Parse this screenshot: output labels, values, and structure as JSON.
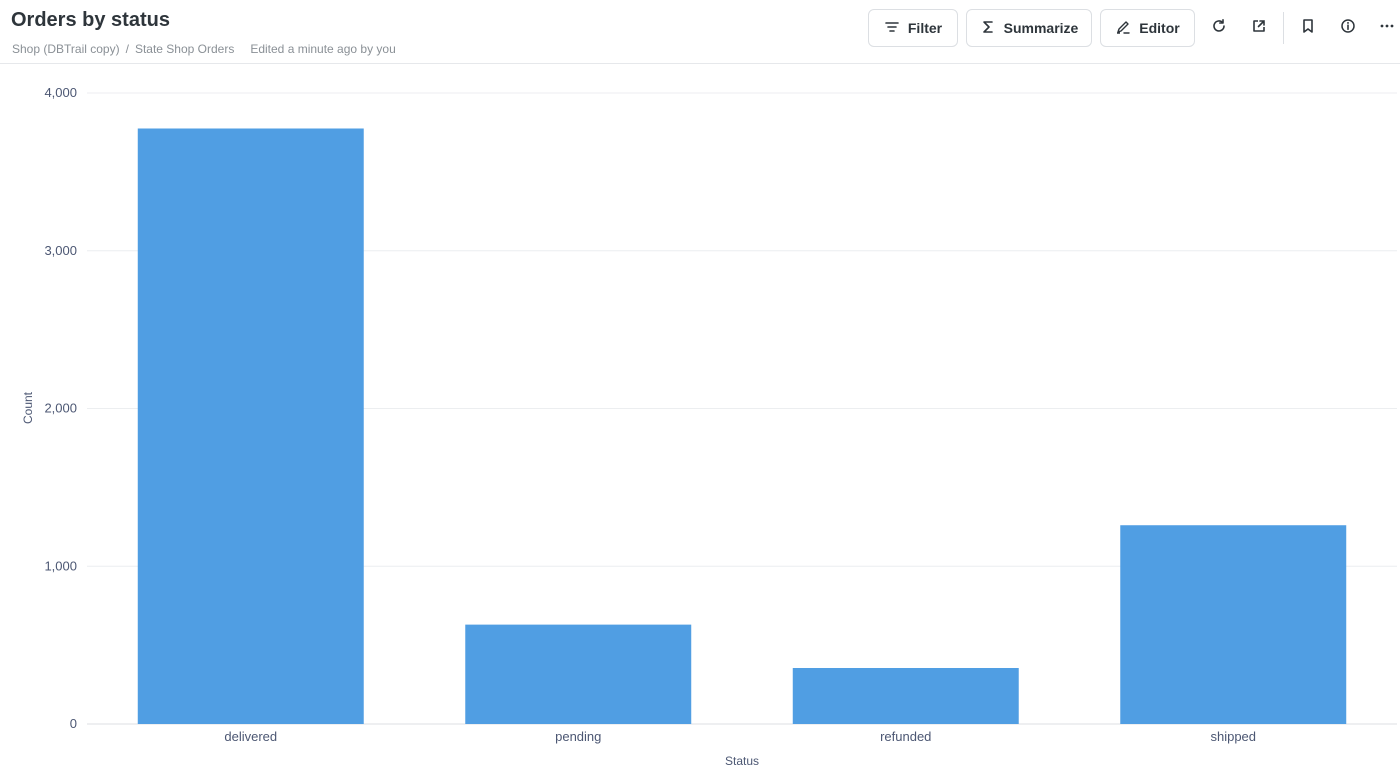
{
  "header": {
    "title": "Orders by status",
    "breadcrumb": [
      "Shop (DBTrail copy)",
      "State Shop Orders"
    ],
    "breadcrumb_sep": "/",
    "edited": "Edited a minute ago by you",
    "buttons": {
      "filter": "Filter",
      "summarize": "Summarize",
      "editor": "Editor"
    },
    "icons": [
      "filter-icon",
      "sigma-icon",
      "pencil-icon",
      "refresh-icon",
      "share-icon",
      "bookmark-icon",
      "info-icon",
      "more-icon"
    ]
  },
  "colors": {
    "bar": "#509ee3",
    "grid": "#eceef0",
    "text": "#4c5773"
  },
  "chart_data": {
    "type": "bar",
    "categories": [
      "delivered",
      "pending",
      "refunded",
      "shipped"
    ],
    "values": [
      3775,
      630,
      355,
      1260
    ],
    "xlabel": "Status",
    "ylabel": "Count",
    "ylim": [
      0,
      4000
    ],
    "yticks": [
      "0",
      "1,000",
      "2,000",
      "3,000",
      "4,000"
    ],
    "grid": true,
    "legend": "none"
  }
}
